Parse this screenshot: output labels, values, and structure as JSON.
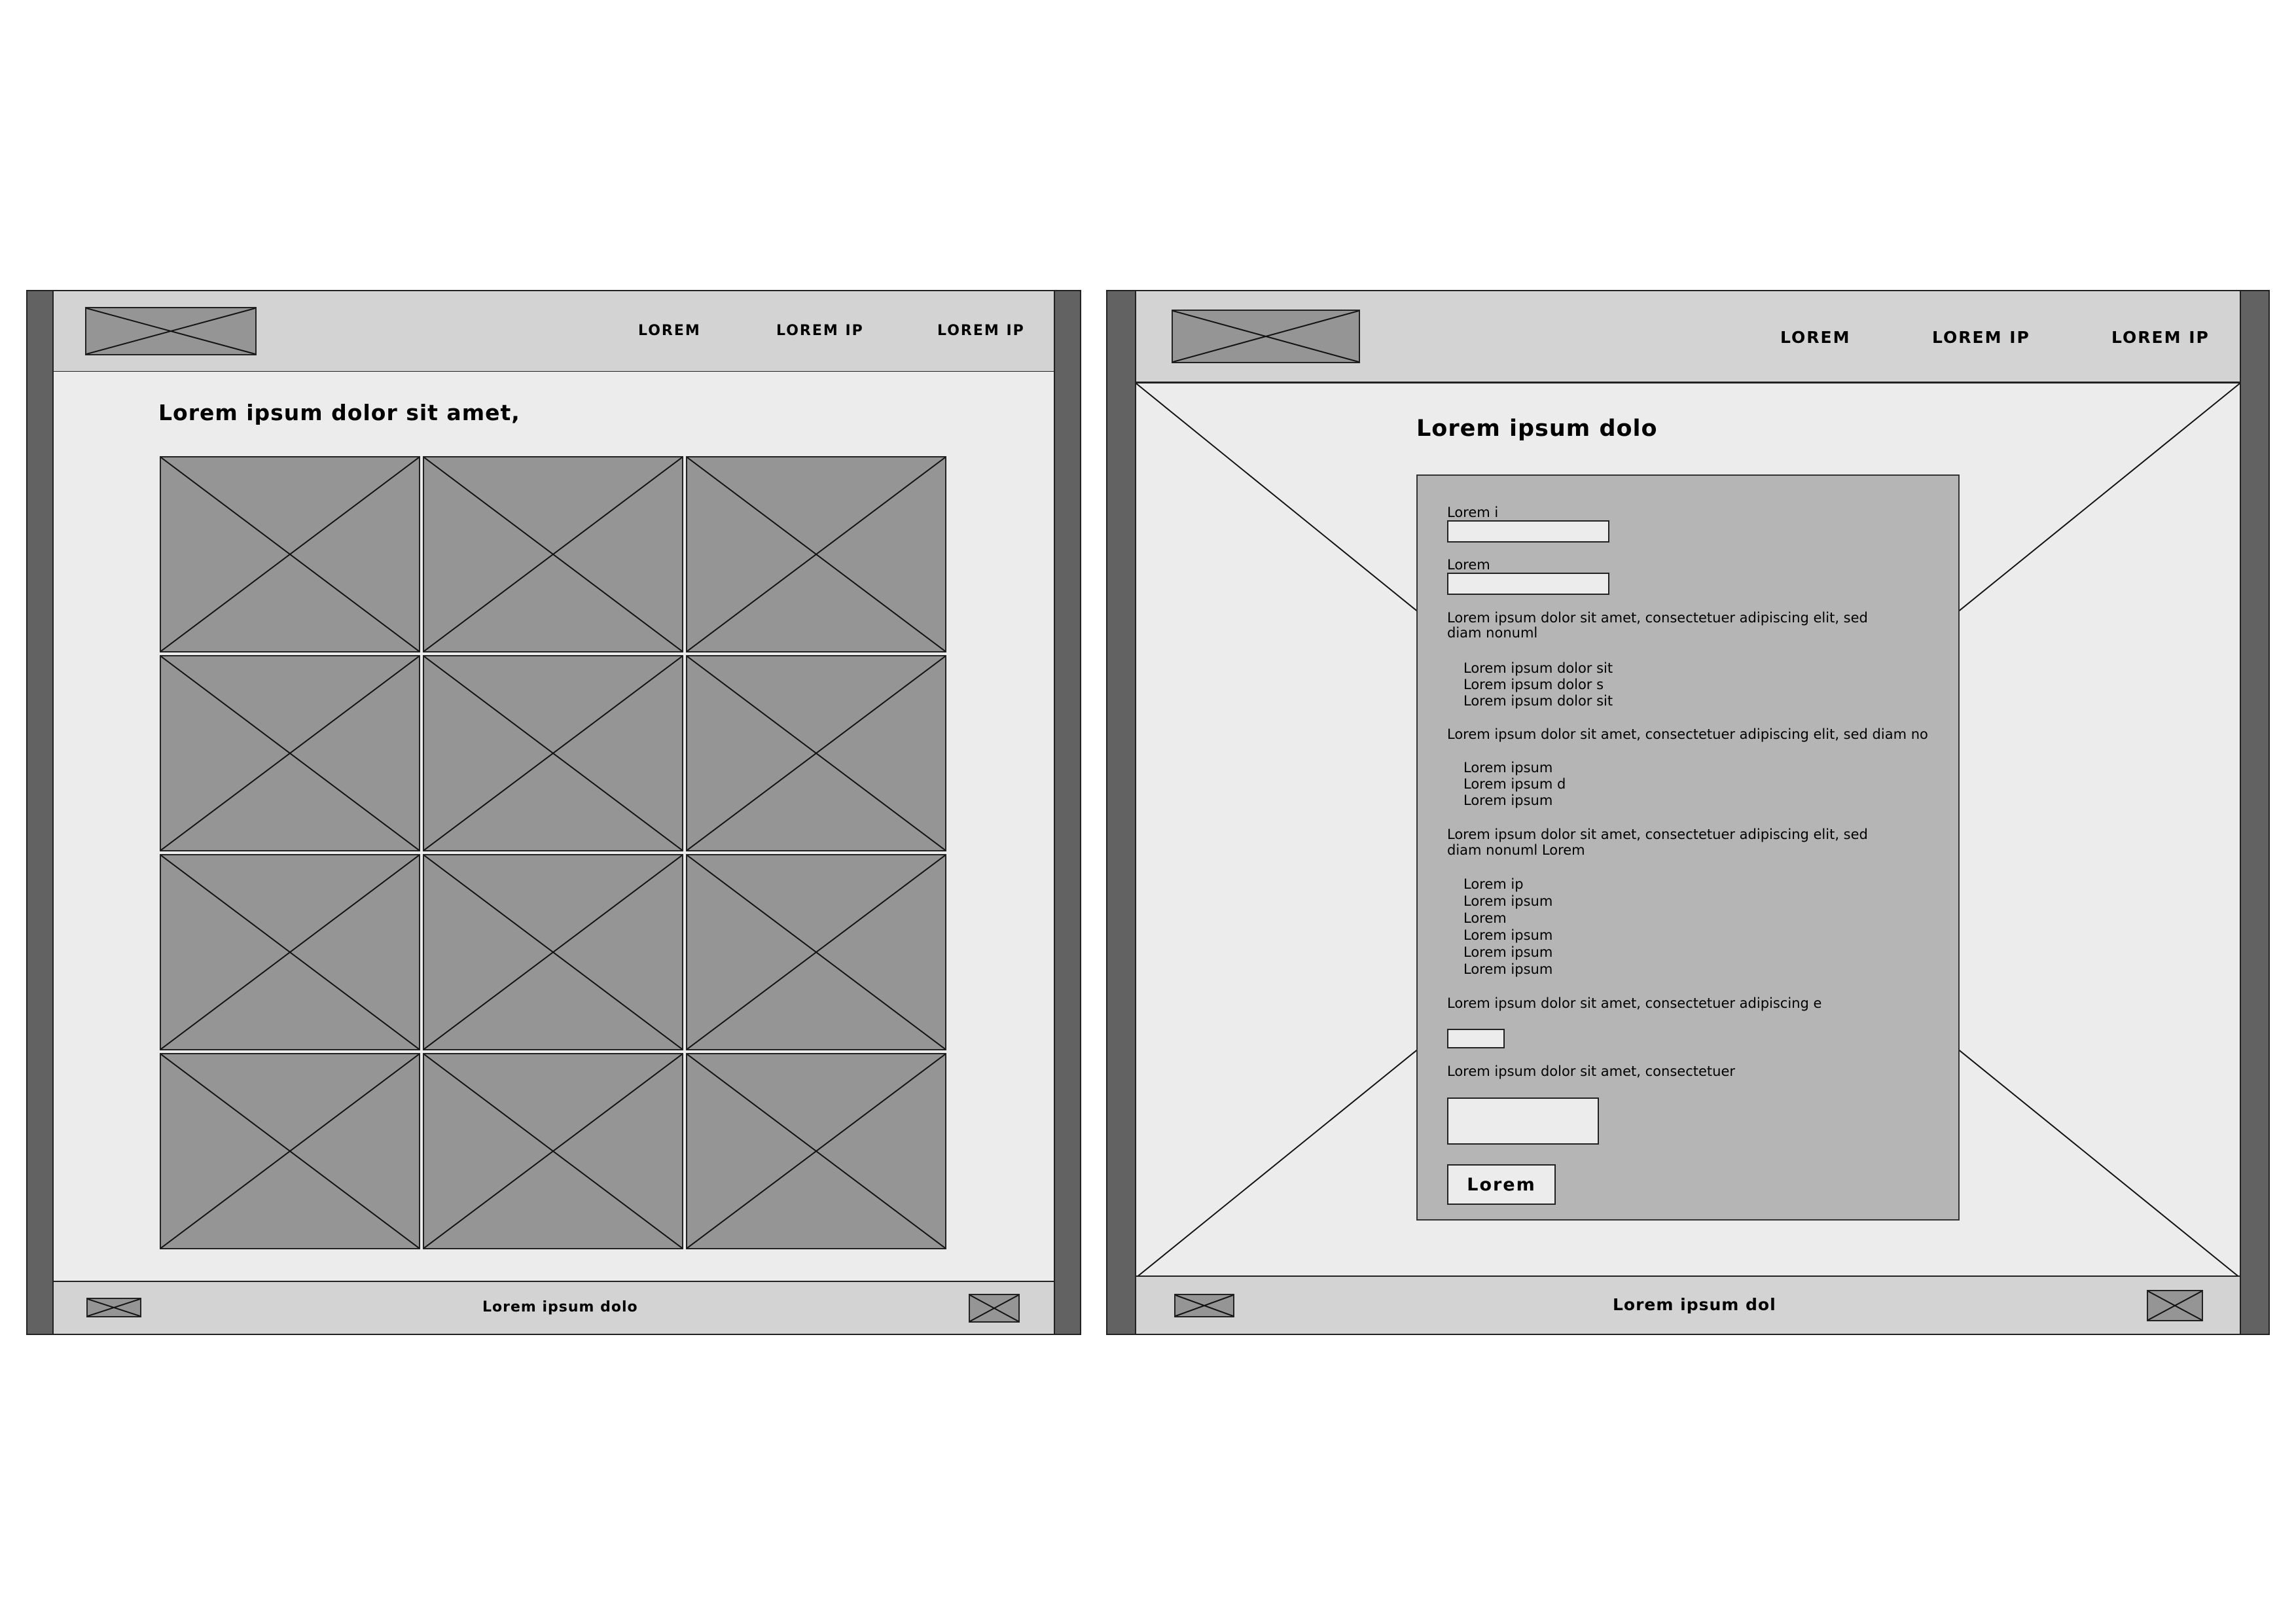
{
  "left_page": {
    "nav": [
      "LOREM",
      "LOREM IP",
      "LOREM IP"
    ],
    "heading": "Lorem ipsum dolor sit amet,",
    "footer": "Lorem ipsum dolo"
  },
  "right_page": {
    "nav": [
      "LOREM",
      "LOREM IP",
      "LOREM IP"
    ],
    "heading": "Lorem ipsum dolo",
    "form": {
      "field1_label": "Lorem i",
      "field2_label": "Lorem",
      "question1": [
        "Lorem ipsum dolor sit amet, consectetuer adipiscing elit, sed",
        "diam nonuml"
      ],
      "options1": [
        "Lorem ipsum dolor sit",
        "Lorem ipsum dolor s",
        "Lorem ipsum dolor sit"
      ],
      "question2": "Lorem ipsum dolor sit amet, consectetuer adipiscing elit, sed diam no",
      "options2": [
        "Lorem ipsum",
        "Lorem ipsum d",
        "Lorem ipsum"
      ],
      "question3": [
        "Lorem ipsum dolor sit amet, consectetuer adipiscing elit, sed",
        "diam nonuml Lorem"
      ],
      "options3": [
        "Lorem ip",
        "Lorem ipsum",
        "Lorem",
        "Lorem ipsum",
        "Lorem ipsum",
        "Lorem ipsum"
      ],
      "question4": "Lorem ipsum dolor sit amet, consectetuer adipiscing e",
      "question5": "Lorem ipsum dolor sit amet, consectetuer",
      "submit_label": "Lorem"
    },
    "footer": "Lorem ipsum dol"
  }
}
